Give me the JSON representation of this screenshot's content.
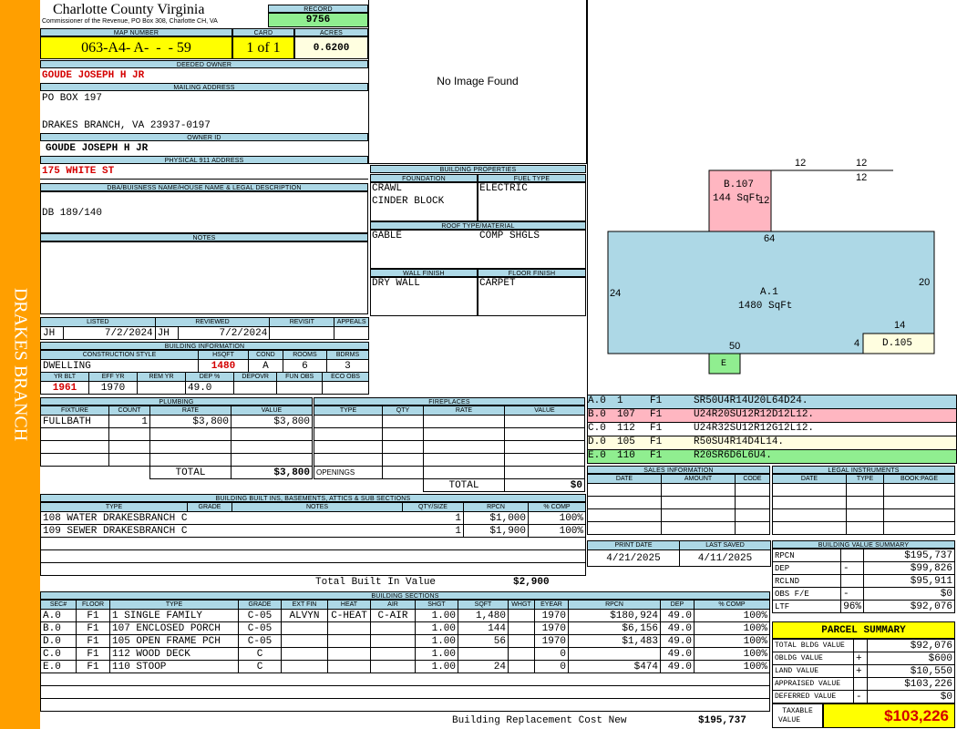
{
  "side_label": "DRAKES BRANCH",
  "county": {
    "title": "Charlotte County Virginia",
    "subtitle": "Commissioner of the Revenue, PO Box 308, Charlotte CH, VA"
  },
  "record": {
    "label": "RECORD",
    "value": "9756"
  },
  "map": {
    "label": "MAP NUMBER",
    "value": "063-A4- A-  -  - 59"
  },
  "card": {
    "label": "CARD",
    "value": "1 of 1"
  },
  "acres": {
    "label": "ACRES",
    "value": "0.6200"
  },
  "deeded_owner": {
    "label": "DEEDED OWNER",
    "value": "GOUDE JOSEPH H JR"
  },
  "mailing": {
    "label": "MAILING ADDRESS",
    "line1": "PO BOX 197",
    "line2": "DRAKES BRANCH, VA 23937-0197"
  },
  "owner_id": {
    "label": "OWNER ID",
    "value": "GOUDE JOSEPH H JR"
  },
  "physical": {
    "label": "PHYSICAL 911 ADDRESS",
    "value": "175 WHITE ST"
  },
  "dba": {
    "label": "DBA/BUISNESS NAME/HOUSE NAME & LEGAL DESCRIPTION",
    "value": "DB 189/140"
  },
  "notes": {
    "label": "NOTES",
    "value": ""
  },
  "image_text": "No Image Found",
  "listing": {
    "listed_label": "LISTED",
    "reviewed_label": "REVIEWED",
    "revisit_label": "REVISIT",
    "appeals_label": "APPEALS",
    "listed_by": "JH",
    "listed_date": "7/2/2024",
    "reviewed_by": "JH",
    "reviewed_date": "7/2/2024"
  },
  "building_info": {
    "label": "BUILDING INFORMATION",
    "headers": [
      "CONSTRUCTION STYLE",
      "HSQFT",
      "COND",
      "ROOMS",
      "BDRMS"
    ],
    "style": "DWELLING",
    "hsqft": "1480",
    "cond": "A",
    "rooms": "6",
    "bdrms": "3",
    "headers2": [
      "YR BLT",
      "EFF YR",
      "REM YR",
      "DEP %",
      "DEPOVR",
      "FUN OBS",
      "ECO OBS"
    ],
    "yr_blt": "1961",
    "eff_yr": "1970",
    "dep": "49.0"
  },
  "building_props": {
    "label": "BUILDING PROPERTIES",
    "foundation_label": "FOUNDATION",
    "fuel_label": "FUEL TYPE",
    "foundation1": "CRAWL",
    "foundation2": "CINDER BLOCK",
    "fuel": "ELECTRIC",
    "roof_label": "ROOF TYPE/MATERIAL",
    "roof1": "GABLE",
    "roof2": "COMP SHGLS",
    "wall_label": "WALL FINISH",
    "floor_label": "FLOOR FINISH",
    "wall": "DRY WALL",
    "floor": "CARPET"
  },
  "sketch": {
    "labels": {
      "b_name": "B.107",
      "b_area": "144 SqFt",
      "a_name": "A.1",
      "a_area": "1480 SqFt",
      "d_name": "D.105",
      "e_name": "E"
    },
    "dims": {
      "d12a": "12",
      "d12b": "12",
      "d12c": "12",
      "d12d": "12",
      "d64": "64",
      "d24": "24",
      "d20": "20",
      "d14": "14",
      "d4": "4",
      "d50": "50"
    }
  },
  "vectors": [
    {
      "code": "A.0",
      "num": "1",
      "fl": "F1",
      "vec": "SR50U4R14U20L64D24.",
      "color": "#add8e6"
    },
    {
      "code": "B.0",
      "num": "107",
      "fl": "F1",
      "vec": "U24R20SU12R12D12L12.",
      "color": "#ffb6c1"
    },
    {
      "code": "C.0",
      "num": "112",
      "fl": "F1",
      "vec": "U24R32SU12R12G12L12.",
      "color": "#ffffff"
    },
    {
      "code": "D.0",
      "num": "105",
      "fl": "F1",
      "vec": "R50SU4R14D4L14.",
      "color": "#fffee0"
    },
    {
      "code": "E.0",
      "num": "110",
      "fl": "F1",
      "vec": "R20SR6D6L6U4.",
      "color": "#90ee90"
    }
  ],
  "plumbing": {
    "label": "PLUMBING",
    "headers": [
      "FIXTURE",
      "COUNT",
      "RATE",
      "VALUE"
    ],
    "rows": [
      {
        "fixture": "FULLBATH",
        "count": "1",
        "rate": "$3,800",
        "value": "$3,800"
      }
    ],
    "total_label": "TOTAL",
    "total": "$3,800"
  },
  "fireplaces": {
    "label": "FIREPLACES",
    "headers": [
      "TYPE",
      "QTY",
      "RATE",
      "VALUE"
    ],
    "openings_label": "OPENINGS",
    "total_label": "TOTAL",
    "total": "$0"
  },
  "sales": {
    "label": "SALES INFORMATION",
    "headers": [
      "DATE",
      "AMOUNT",
      "CODE"
    ]
  },
  "legal": {
    "label": "LEGAL INSTRUMENTS",
    "headers": [
      "DATE",
      "TYPE",
      "BOOK:PAGE"
    ]
  },
  "built_ins": {
    "label": "BUILDING BUILT INS, BASEMENTS, ATTICS & SUB SECTIONS",
    "headers": [
      "TYPE",
      "GRADE",
      "NOTES",
      "QTY/SIZE",
      "RPCN",
      "% COMP"
    ],
    "rows": [
      {
        "type": "108 WATER DRAKESBRANCH C",
        "qty": "1",
        "rpcn": "$1,000",
        "comp": "100%"
      },
      {
        "type": "109 SEWER DRAKESBRANCH C",
        "qty": "1",
        "rpcn": "$1,900",
        "comp": "100%"
      }
    ],
    "total_label": "Total Built In Value",
    "total": "$2,900"
  },
  "dates": {
    "print_label": "PRINT DATE",
    "saved_label": "LAST SAVED",
    "print": "4/21/2025",
    "saved": "4/11/2025"
  },
  "value_summary": {
    "label": "BUILDING VALUE SUMMARY",
    "rows": [
      {
        "name": "RPCN",
        "op": "",
        "val": "$195,737"
      },
      {
        "name": "DEP",
        "op": "-",
        "val": "$99,826"
      },
      {
        "name": "RCLND",
        "op": "",
        "val": "$95,911"
      },
      {
        "name": "OBS F/E",
        "op": "-",
        "val": "$0"
      },
      {
        "name": "LTF",
        "op": "96%",
        "val": "$92,076"
      }
    ]
  },
  "sections": {
    "label": "BUILDING SECTIONS",
    "headers": [
      "SEC#",
      "FLOOR",
      "TYPE",
      "GRADE",
      "EXT FIN",
      "HEAT",
      "AIR",
      "SHGT",
      "SQFT",
      "WHGT",
      "EYEAR",
      "RPCN",
      "DEP",
      "% COMP"
    ],
    "rows": [
      {
        "sec": "A.0",
        "floor": "F1",
        "type": "1 SINGLE FAMILY",
        "grade": "C-05",
        "ext": "ALVYN",
        "heat": "C-HEAT",
        "air": "C-AIR",
        "shgt": "1.00",
        "sqft": "1,480",
        "whgt": "",
        "eyear": "1970",
        "rpcn": "$180,924",
        "dep": "49.0",
        "comp": "100%"
      },
      {
        "sec": "B.0",
        "floor": "F1",
        "type": "107 ENCLOSED PORCH",
        "grade": "C-05",
        "ext": "",
        "heat": "",
        "air": "",
        "shgt": "1.00",
        "sqft": "144",
        "whgt": "",
        "eyear": "1970",
        "rpcn": "$6,156",
        "dep": "49.0",
        "comp": "100%"
      },
      {
        "sec": "D.0",
        "floor": "F1",
        "type": "105 OPEN FRAME PCH",
        "grade": "C-05",
        "ext": "",
        "heat": "",
        "air": "",
        "shgt": "1.00",
        "sqft": "56",
        "whgt": "",
        "eyear": "1970",
        "rpcn": "$1,483",
        "dep": "49.0",
        "comp": "100%"
      },
      {
        "sec": "C.0",
        "floor": "F1",
        "type": "112 WOOD DECK",
        "grade": "C",
        "ext": "",
        "heat": "",
        "air": "",
        "shgt": "1.00",
        "sqft": "",
        "whgt": "",
        "eyear": "0",
        "rpcn": "",
        "dep": "49.0",
        "comp": "100%"
      },
      {
        "sec": "E.0",
        "floor": "F1",
        "type": "110 STOOP",
        "grade": "C",
        "ext": "",
        "heat": "",
        "air": "",
        "shgt": "1.00",
        "sqft": "24",
        "whgt": "",
        "eyear": "0",
        "rpcn": "$474",
        "dep": "49.0",
        "comp": "100%"
      }
    ],
    "total_label": "Building Replacement Cost New",
    "total": "$195,737"
  },
  "parcel": {
    "label": "PARCEL SUMMARY",
    "rows": [
      {
        "name": "TOTAL BLDG VALUE",
        "op": "",
        "val": "$92,076"
      },
      {
        "name": "OBLDG VALUE",
        "op": "+",
        "val": "$600"
      },
      {
        "name": "LAND VALUE",
        "op": "+",
        "val": "$10,550"
      },
      {
        "name": "APPRAISED VALUE",
        "op": "",
        "val": "$103,226"
      },
      {
        "name": "DEFERRED VALUE",
        "op": "-",
        "val": "$0"
      }
    ],
    "taxable_label1": "TAXABLE",
    "taxable_label2": "VALUE",
    "taxable": "$103,226"
  },
  "colors": {
    "side": "#ff9f00",
    "header": "#add8e6",
    "yellow": "#ffff00",
    "green": "#90ee90",
    "red": "#d40000"
  }
}
